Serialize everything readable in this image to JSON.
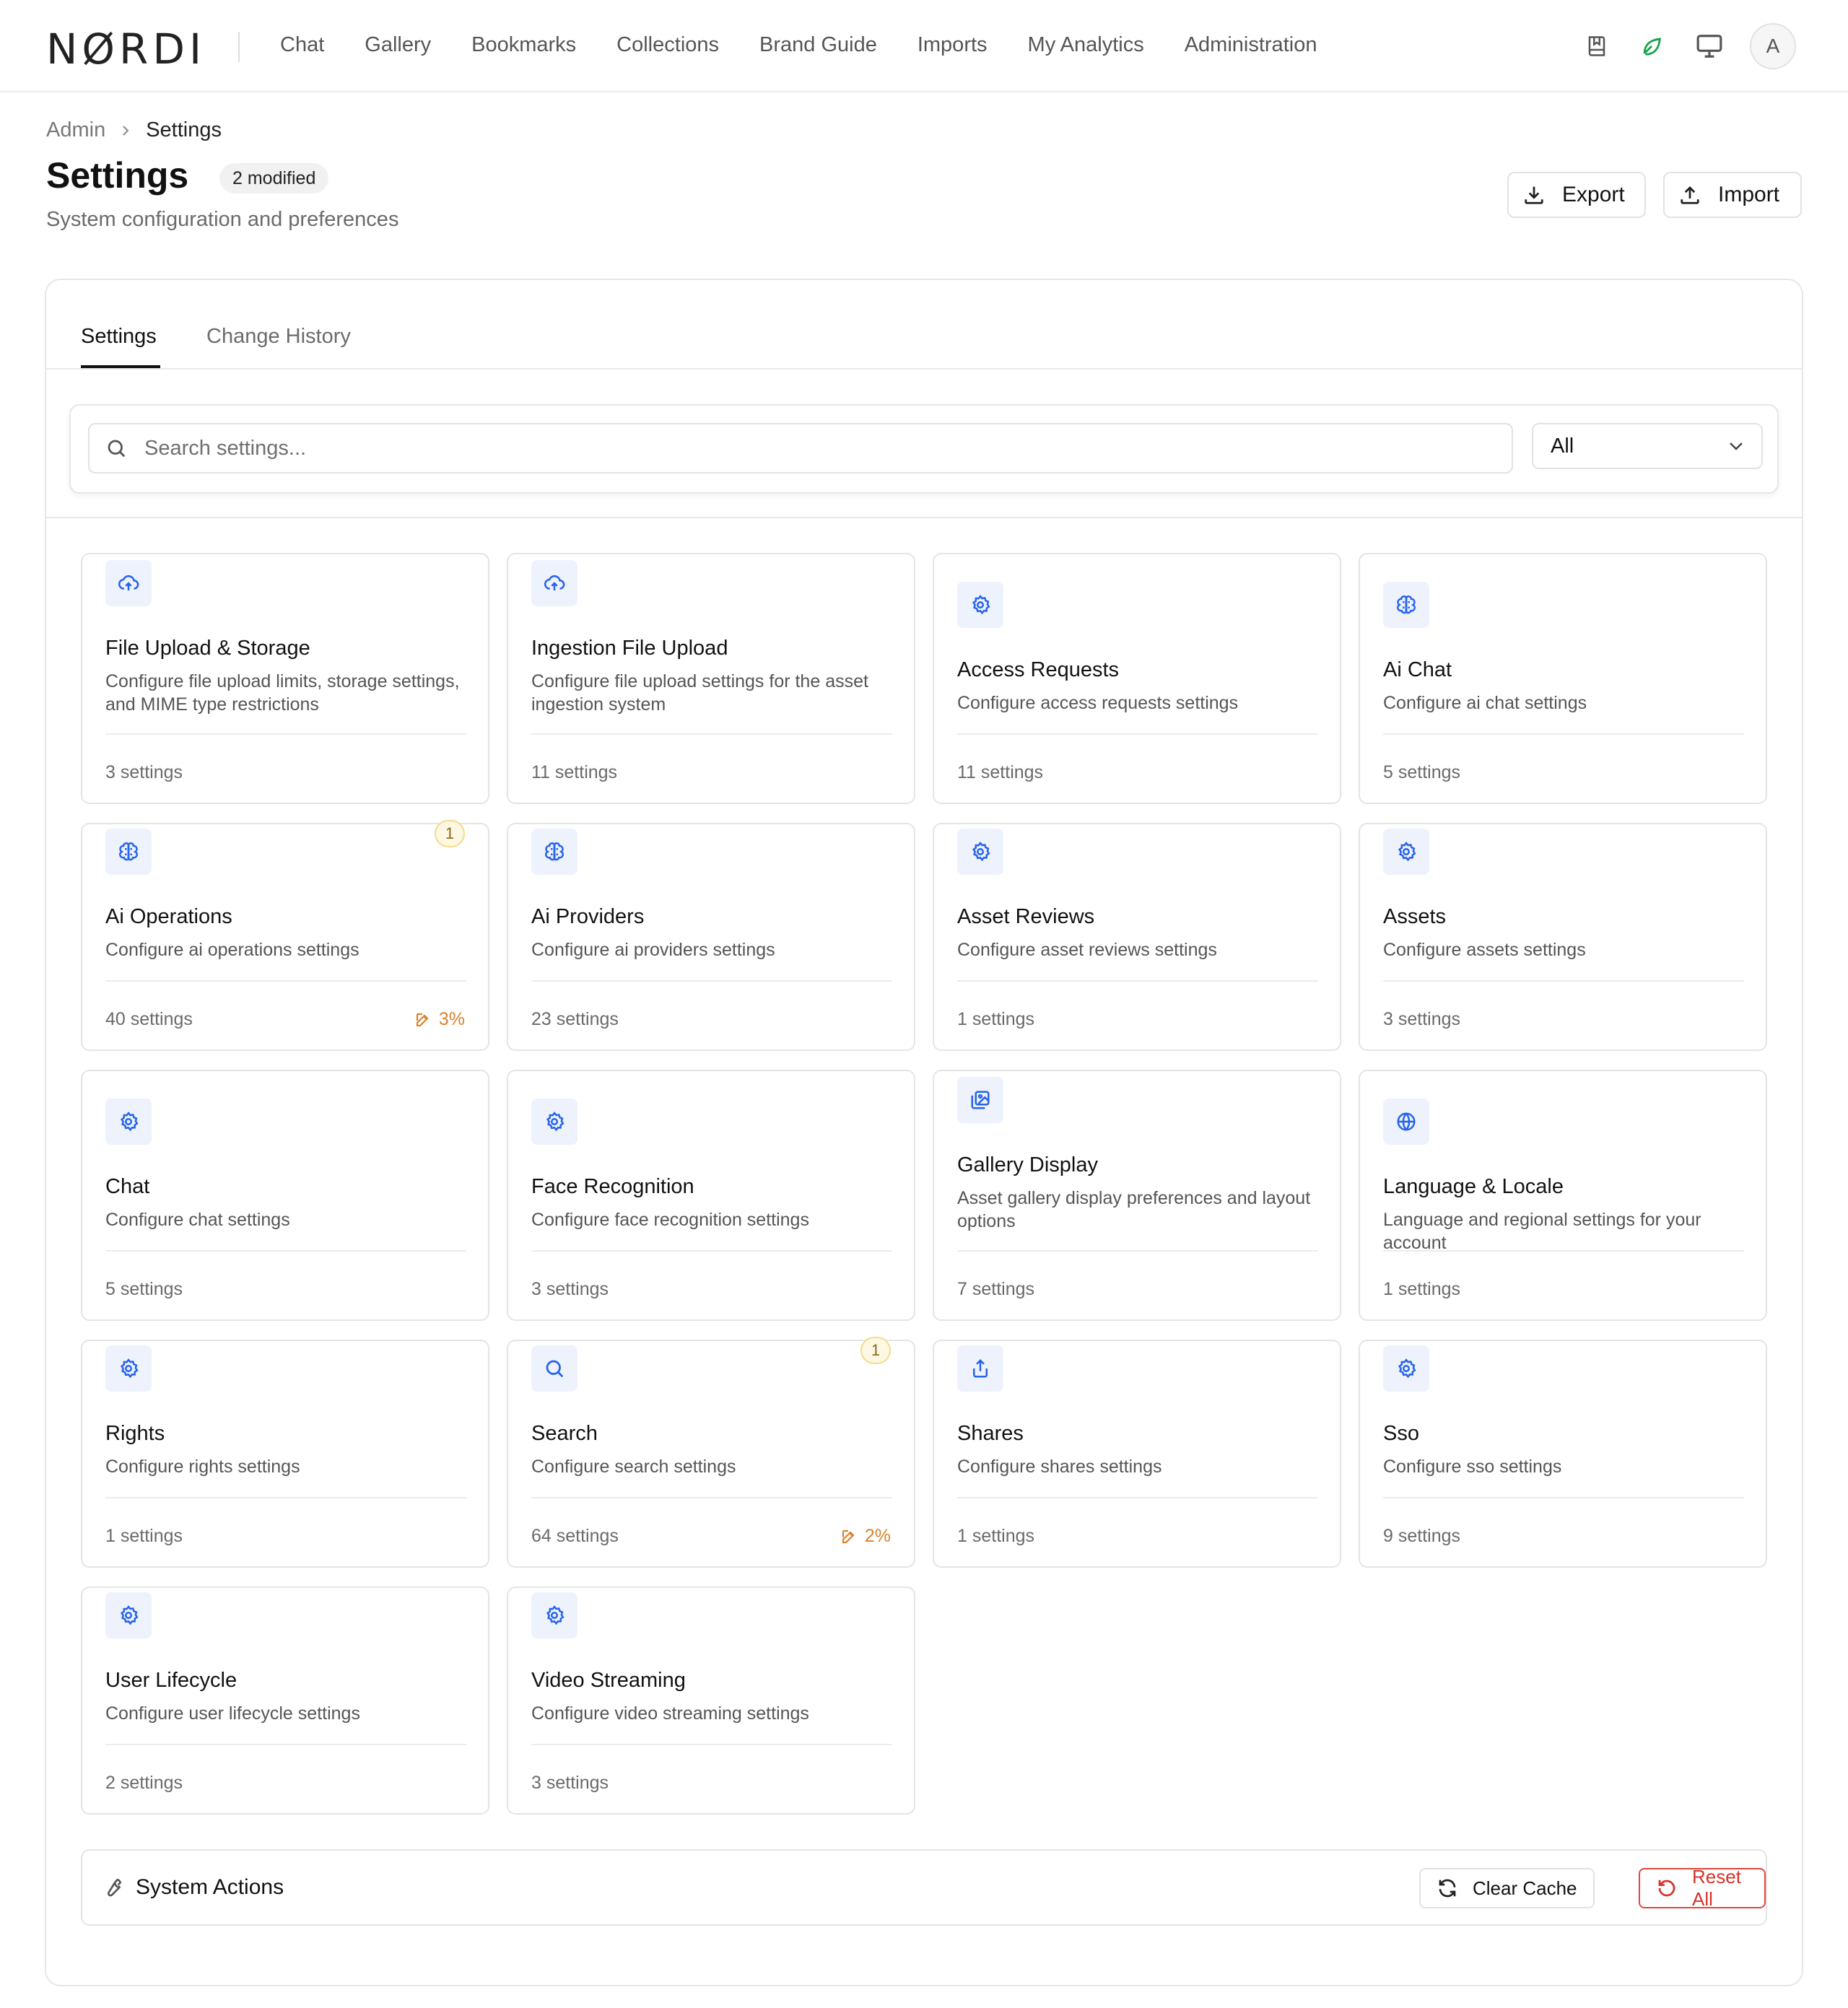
{
  "brand": {
    "logo": "NØRDI"
  },
  "nav": {
    "items": [
      "Chat",
      "Gallery",
      "Bookmarks",
      "Collections",
      "Brand Guide",
      "Imports",
      "My Analytics",
      "Administration"
    ],
    "avatar": "A",
    "icons": [
      "book-icon",
      "leaf-icon",
      "monitor-icon"
    ]
  },
  "breadcrumb": {
    "parent": "Admin",
    "current": "Settings"
  },
  "header": {
    "title": "Settings",
    "badge": "2 modified",
    "subtitle": "System configuration and preferences",
    "export_label": "Export",
    "import_label": "Import"
  },
  "tabs": {
    "settings": "Settings",
    "history": "Change History"
  },
  "filter": {
    "search_placeholder": "Search settings...",
    "select_value": "All"
  },
  "cards": [
    {
      "title": "File Upload & Storage",
      "desc": "Configure file upload limits, storage settings, and MIME type restrictions",
      "count": "3 settings",
      "icon": "cloud-upload-icon"
    },
    {
      "title": "Ingestion File Upload",
      "desc": "Configure file upload settings for the asset ingestion system",
      "count": "11 settings",
      "icon": "cloud-upload-icon"
    },
    {
      "title": "Access Requests",
      "desc": "Configure access requests settings",
      "count": "11 settings",
      "icon": "gear-icon"
    },
    {
      "title": "Ai Chat",
      "desc": "Configure ai chat settings",
      "count": "5 settings",
      "icon": "brain-icon"
    },
    {
      "title": "Ai Operations",
      "desc": "Configure ai operations settings",
      "count": "40 settings",
      "icon": "brain-icon",
      "badge": "1",
      "pct": "3%"
    },
    {
      "title": "Ai Providers",
      "desc": "Configure ai providers settings",
      "count": "23 settings",
      "icon": "brain-icon"
    },
    {
      "title": "Asset Reviews",
      "desc": "Configure asset reviews settings",
      "count": "1 settings",
      "icon": "gear-icon"
    },
    {
      "title": "Assets",
      "desc": "Configure assets settings",
      "count": "3 settings",
      "icon": "gear-icon"
    },
    {
      "title": "Chat",
      "desc": "Configure chat settings",
      "count": "5 settings",
      "icon": "gear-icon"
    },
    {
      "title": "Face Recognition",
      "desc": "Configure face recognition settings",
      "count": "3 settings",
      "icon": "gear-icon"
    },
    {
      "title": "Gallery Display",
      "desc": "Asset gallery display preferences and layout options",
      "count": "7 settings",
      "icon": "images-icon"
    },
    {
      "title": "Language & Locale",
      "desc": "Language and regional settings for your account",
      "count": "1 settings",
      "icon": "globe-icon"
    },
    {
      "title": "Rights",
      "desc": "Configure rights settings",
      "count": "1 settings",
      "icon": "gear-icon"
    },
    {
      "title": "Search",
      "desc": "Configure search settings",
      "count": "64 settings",
      "icon": "search-icon",
      "badge": "1",
      "pct": "2%"
    },
    {
      "title": "Shares",
      "desc": "Configure shares settings",
      "count": "1 settings",
      "icon": "share-icon"
    },
    {
      "title": "Sso",
      "desc": "Configure sso settings",
      "count": "9 settings",
      "icon": "gear-icon"
    },
    {
      "title": "User Lifecycle",
      "desc": "Configure user lifecycle settings",
      "count": "2 settings",
      "icon": "gear-icon"
    },
    {
      "title": "Video Streaming",
      "desc": "Configure video streaming settings",
      "count": "3 settings",
      "icon": "gear-icon"
    }
  ],
  "system_actions": {
    "title": "System Actions",
    "clear_label": "Clear Cache",
    "reset_label": "Reset All"
  },
  "colors": {
    "accent_icon": "#2563eb",
    "icon_bg": "#eef2fd",
    "warning": "#d9822b",
    "danger": "#d7322b",
    "leaf": "#16a34a"
  }
}
